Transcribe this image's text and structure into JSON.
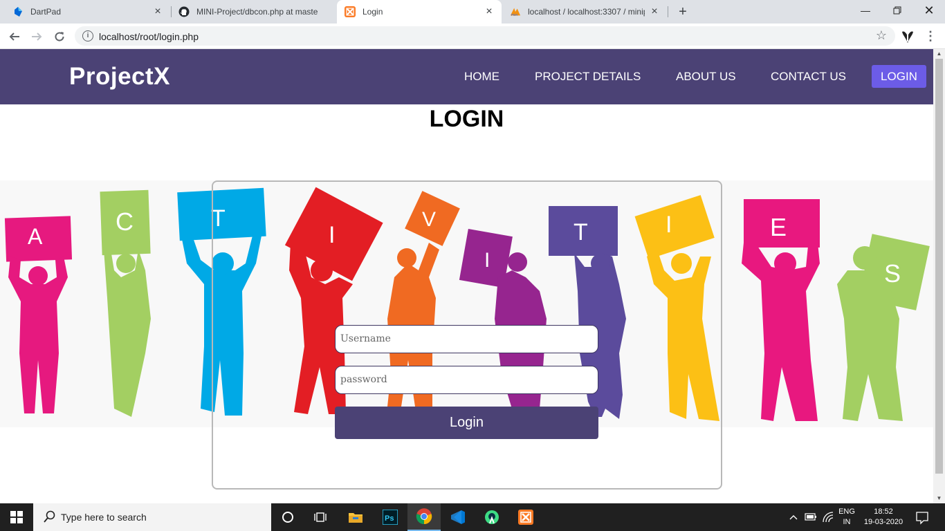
{
  "browser": {
    "tabs": [
      {
        "title": "DartPad",
        "icon": "dartpad-icon",
        "active": false
      },
      {
        "title": "MINI-Project/dbcon.php at maste",
        "icon": "github-icon",
        "active": false
      },
      {
        "title": "Login",
        "icon": "xampp-icon",
        "active": true
      },
      {
        "title": "localhost / localhost:3307 / minip",
        "icon": "phpmyadmin-icon",
        "active": false
      }
    ],
    "url": "localhost/root/login.php"
  },
  "site": {
    "logo": "ProjectX",
    "nav": [
      "HOME",
      "PROJECT DETAILS",
      "ABOUT US",
      "CONTACT US"
    ],
    "nav_login": "LOGIN"
  },
  "page": {
    "heading": "LOGIN",
    "hero_letters": [
      "A",
      "C",
      "T",
      "I",
      "V",
      "I",
      "T",
      "I",
      "E",
      "S"
    ],
    "username_placeholder": "Username",
    "password_placeholder": "password",
    "submit_label": "Login"
  },
  "taskbar": {
    "search_placeholder": "Type here to search",
    "lang_top": "ENG",
    "lang_bottom": "IN",
    "time": "18:52",
    "date": "19-03-2020"
  },
  "colors": {
    "nav_bg": "#4b4275",
    "login_button": "#6c5ce7",
    "submit_button": "#4b4275"
  }
}
